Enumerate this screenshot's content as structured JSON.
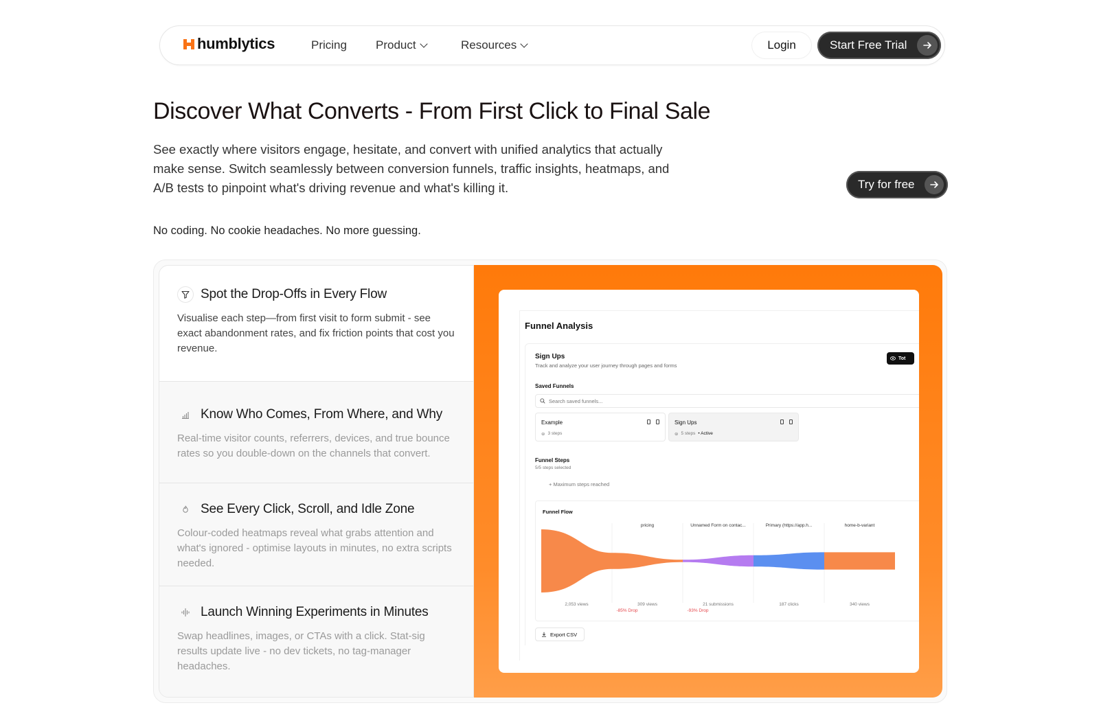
{
  "nav": {
    "logo_text": "humblytics",
    "links": [
      "Pricing",
      "Product",
      "Resources"
    ],
    "login_label": "Login",
    "trial_label": "Start Free Trial"
  },
  "hero": {
    "title": "Discover What Converts - From First Click to Final Sale",
    "description": "See exactly where visitors engage, hesitate, and convert with unified analytics that actually make sense. Switch seamlessly between conversion funnels, traffic insights, heatmaps, and A/B tests to pinpoint what's driving revenue and what's killing it.",
    "cta_label": "Try for free",
    "tagline": "No coding. No cookie headaches. No more guessing."
  },
  "features": [
    {
      "title": "Spot the Drop-Offs in Every Flow",
      "desc": "Visualise each step—from first visit to form submit - see exact abandonment rates, and fix friction points that cost you revenue.",
      "icon": "filter-icon",
      "active": true
    },
    {
      "title": "Know Who Comes, From Where, and Why",
      "desc": "Real-time visitor counts, referrers, devices, and true bounce rates so you double-down on the channels that convert.",
      "icon": "bar-chart-icon",
      "active": false
    },
    {
      "title": "See Every Click, Scroll, and Idle Zone",
      "desc": "Colour-coded heatmaps reveal what grabs attention and what's ignored - optimise layouts in minutes, no extra scripts needed.",
      "icon": "flame-icon",
      "active": false
    },
    {
      "title": "Launch Winning Experiments in Minutes",
      "desc": "Swap headlines, images, or CTAs with a click. Stat-sig results update live - no dev tickets, no tag-manager headaches.",
      "icon": "split-icon",
      "active": false
    }
  ],
  "dashboard": {
    "title": "Funnel Analysis",
    "funnel_name": "Sign Ups",
    "funnel_subtitle": "Track and analyze your user journey through pages and forms",
    "toggle_label": "Tot",
    "saved_label": "Saved Funnels",
    "search_placeholder": "Search saved funnels...",
    "saved": [
      {
        "name": "Example",
        "steps": "3 steps",
        "badge": ""
      },
      {
        "name": "Sign Ups",
        "steps": "5 steps",
        "badge": "• Active"
      }
    ],
    "steps_label": "Funnel Steps",
    "steps_sub": "5/5 steps selected",
    "max_steps": "+ Maximum steps reached",
    "flow_title": "Funnel Flow",
    "export_label": "Export CSV"
  },
  "chart_data": {
    "type": "area",
    "title": "Funnel Flow",
    "categories": [
      "",
      "pricing",
      "Unnamed Form on contac...",
      "Primary (https://app.h...",
      "home-b-variant"
    ],
    "values": [
      2053,
      309,
      21,
      187,
      340
    ],
    "value_labels": [
      "2,053 views",
      "309 views",
      "21 submissions",
      "187 clicks",
      "340 views"
    ],
    "drops": [
      "",
      "-85% Drop",
      "-93% Drop",
      "",
      ""
    ],
    "colors": [
      "#f7894a",
      "#f7894a",
      "#b57bf0",
      "#5b8ff0",
      "#f7894a"
    ]
  }
}
